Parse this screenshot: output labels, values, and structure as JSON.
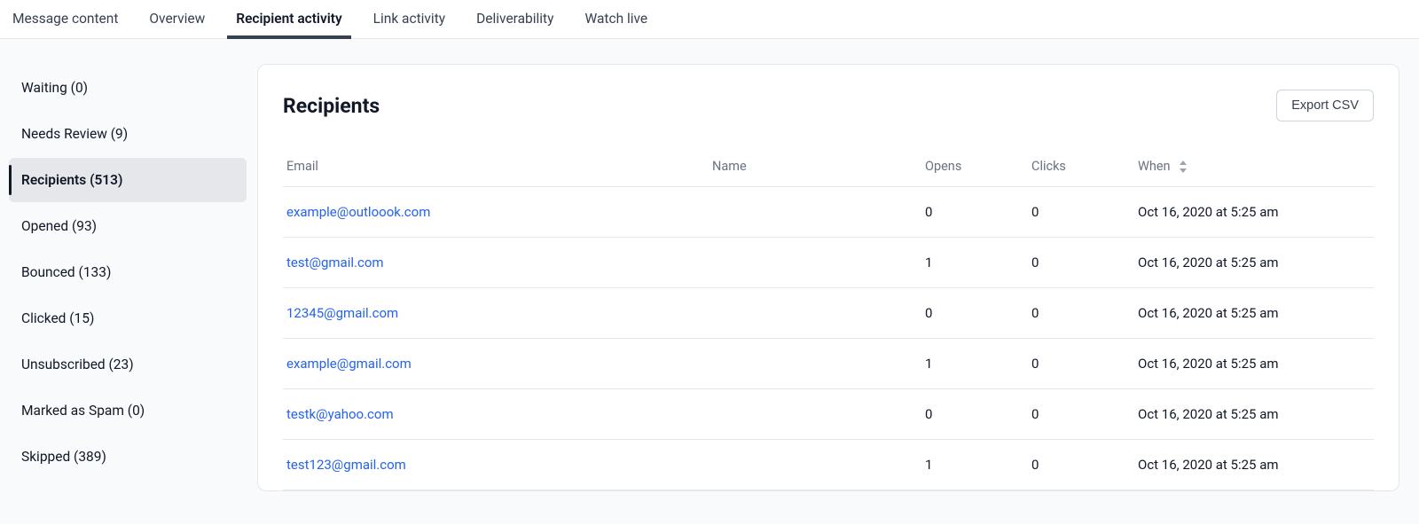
{
  "tabs": [
    {
      "label": "Message content"
    },
    {
      "label": "Overview"
    },
    {
      "label": "Recipient activity"
    },
    {
      "label": "Link activity"
    },
    {
      "label": "Deliverability"
    },
    {
      "label": "Watch live"
    }
  ],
  "activeTab": "Recipient activity",
  "sidebar": {
    "items": [
      {
        "label": "Waiting (0)"
      },
      {
        "label": "Needs Review (9)"
      },
      {
        "label": "Recipients (513)"
      },
      {
        "label": "Opened (93)"
      },
      {
        "label": "Bounced (133)"
      },
      {
        "label": "Clicked (15)"
      },
      {
        "label": "Unsubscribed (23)"
      },
      {
        "label": "Marked as Spam (0)"
      },
      {
        "label": "Skipped (389)"
      }
    ],
    "activeItem": "Recipients (513)"
  },
  "panel": {
    "title": "Recipients",
    "export_label": "Export CSV"
  },
  "table": {
    "columns": {
      "email": "Email",
      "name": "Name",
      "opens": "Opens",
      "clicks": "Clicks",
      "when": "When"
    },
    "rows": [
      {
        "email": "example@outloook.com",
        "name": "",
        "opens": "0",
        "clicks": "0",
        "when": "Oct 16, 2020 at 5:25 am"
      },
      {
        "email": "test@gmail.com",
        "name": "",
        "opens": "1",
        "clicks": "0",
        "when": "Oct 16, 2020 at 5:25 am"
      },
      {
        "email": "12345@gmail.com",
        "name": "",
        "opens": "0",
        "clicks": "0",
        "when": "Oct 16, 2020 at 5:25 am"
      },
      {
        "email": "example@gmail.com",
        "name": "",
        "opens": "1",
        "clicks": "0",
        "when": "Oct 16, 2020 at 5:25 am"
      },
      {
        "email": "testk@yahoo.com",
        "name": "",
        "opens": "0",
        "clicks": "0",
        "when": "Oct 16, 2020 at 5:25 am"
      },
      {
        "email": "test123@gmail.com",
        "name": "",
        "opens": "1",
        "clicks": "0",
        "when": "Oct 16, 2020 at 5:25 am"
      }
    ]
  }
}
